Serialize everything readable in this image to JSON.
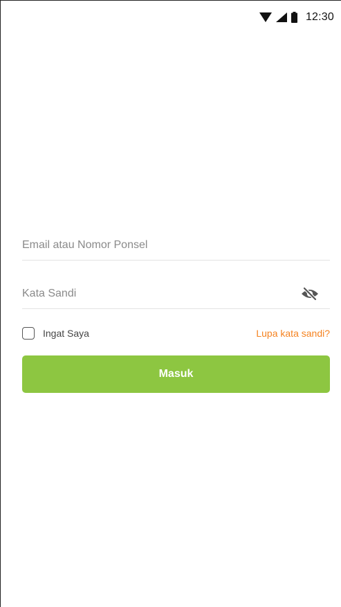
{
  "status_bar": {
    "time": "12:30",
    "icons": [
      "wifi-icon",
      "signal-icon",
      "battery-icon"
    ]
  },
  "login_form": {
    "email_placeholder": "Email atau Nomor Ponsel",
    "email_value": "",
    "password_placeholder": "Kata Sandi",
    "password_value": "",
    "password_toggle_icon": "eye-off-icon",
    "remember_label": "Ingat Saya",
    "remember_checked": false,
    "forgot_label": "Lupa kata sandi?",
    "submit_label": "Masuk"
  },
  "colors": {
    "accent_green": "#8dc641",
    "link_orange": "#f5821f",
    "divider": "#e2e2e2",
    "placeholder": "#8a8a8a"
  }
}
